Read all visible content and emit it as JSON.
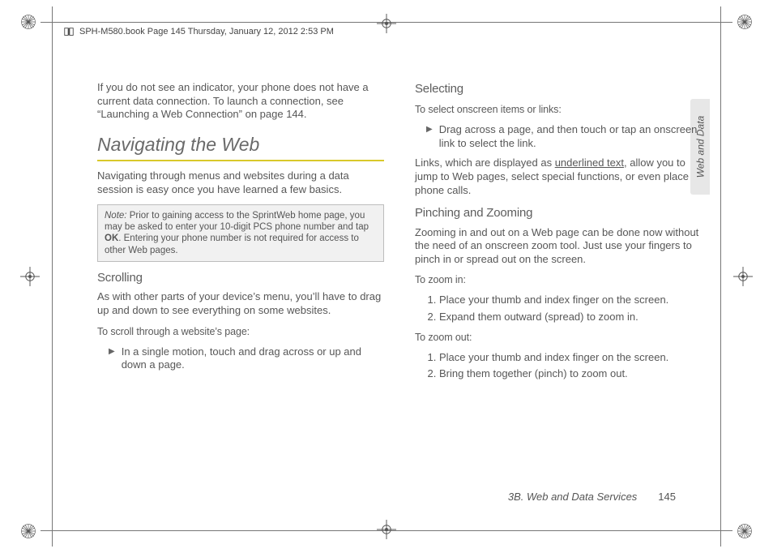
{
  "meta": {
    "header_line": "SPH-M580.book  Page 145  Thursday, January 12, 2012  2:53 PM"
  },
  "sideTab": {
    "label": "Web and Data"
  },
  "footer": {
    "section": "3B. Web and Data Services",
    "page": "145"
  },
  "left": {
    "intro": "If you do not see an indicator, your phone does not have a current data connection. To launch a connection, see “Launching a Web Connection” on page 144.",
    "h2": "Navigating the Web",
    "nav_intro": "Navigating through menus and websites during a data session is easy once you have learned a few basics.",
    "note_label": "Note:",
    "note_pre": "Prior to gaining access to the SprintWeb home page, you may be asked to enter your 10-digit PCS phone number and tap ",
    "note_bold": "OK",
    "note_post": ". Entering your phone number is not required for access to other Web pages.",
    "scrolling_h": "Scrolling",
    "scrolling_p": "As with other parts of your device’s menu, you’ll have to drag up and down to see everything on some websites.",
    "scroll_instr": "To scroll through a website’s page:",
    "scroll_bullet": "In a single motion, touch and drag across or up and down a page."
  },
  "right": {
    "selecting_h": "Selecting",
    "select_instr": "To select onscreen items or links:",
    "select_bullet": "Drag across a page, and then touch or tap an onscreen link to select the link.",
    "links_pre": "Links, which are displayed as ",
    "links_ul": "underlined text",
    "links_post": ", allow you to jump to Web pages, select special functions, or even place phone calls.",
    "pinch_h": "Pinching and Zooming",
    "pinch_p": "Zooming in and out on a Web page can be done now without the need of an onscreen zoom tool. Just use your fingers to pinch in or spread out on the screen.",
    "zoomin_instr": "To zoom in:",
    "zoomin_1": "Place your thumb and index finger on the screen.",
    "zoomin_2": "Expand them outward (spread) to zoom in.",
    "zoomout_instr": "To zoom out:",
    "zoomout_1": "Place your thumb and index finger on the screen.",
    "zoomout_2": "Bring them together (pinch) to zoom out."
  }
}
